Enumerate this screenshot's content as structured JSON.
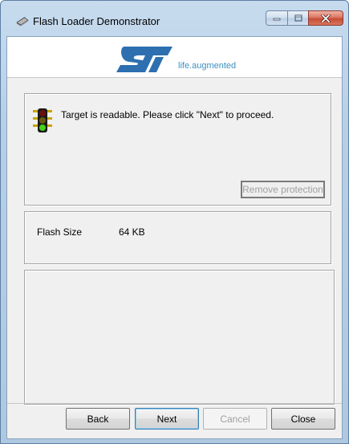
{
  "window": {
    "title": "Flash Loader Demonstrator"
  },
  "banner": {
    "logo_text": "ST",
    "tagline": "life.augmented"
  },
  "status": {
    "message": "Target is readable. Please click \"Next\" to proceed.",
    "icon": "traffic-light-green-icon"
  },
  "buttons": {
    "remove_protection": "Remove protection",
    "back": "Back",
    "next": "Next",
    "cancel": "Cancel",
    "close": "Close"
  },
  "flash": {
    "label": "Flash Size",
    "value": "64 KB"
  },
  "colors": {
    "st_blue": "#2e6fb0",
    "tagline_blue": "#3f8fc0",
    "light_green": "#44d21a"
  }
}
